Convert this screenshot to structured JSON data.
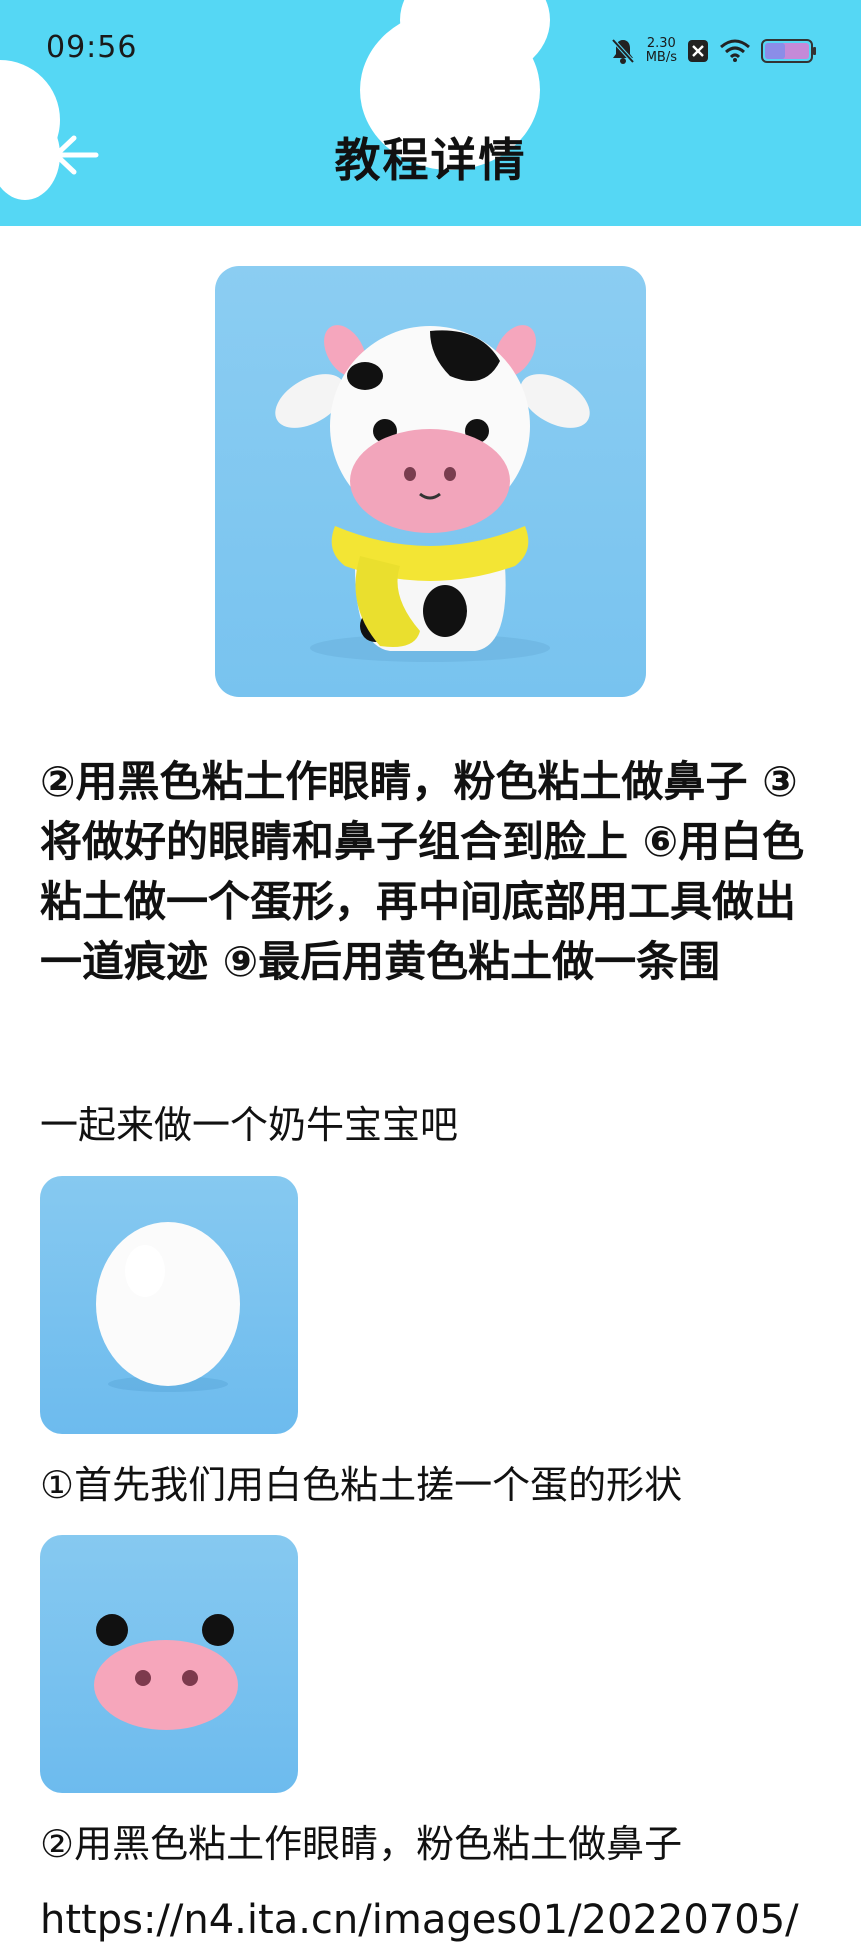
{
  "status_bar": {
    "time": "09:56",
    "net_speed_value": "2.30",
    "net_speed_unit": "MB/s",
    "icons": [
      "mute-bell-icon",
      "sim-x-icon",
      "wifi-icon",
      "battery-icon"
    ]
  },
  "nav": {
    "title": "教程详情",
    "back_icon": "arrow-left-icon"
  },
  "colors": {
    "header_bg": "#55d7f4",
    "image_bg": "#7fc6f0"
  },
  "content": {
    "summary": "②用黑色粘土作眼睛，粉色粘土做鼻子 ③将做好的眼睛和鼻子组合到脸上 ⑥用白色粘土做一个蛋形，再中间底部用工具做出一道痕迹 ⑨最后用黄色粘土做一条围",
    "intro": "一起来做一个奶牛宝宝吧",
    "steps": [
      {
        "caption": "①首先我们用白色粘土搓一个蛋的形状"
      },
      {
        "caption": "②用黑色粘土作眼睛，粉色粘土做鼻子"
      }
    ],
    "truncated_url": "https://n4.ita.cn/images01/20220705/"
  }
}
